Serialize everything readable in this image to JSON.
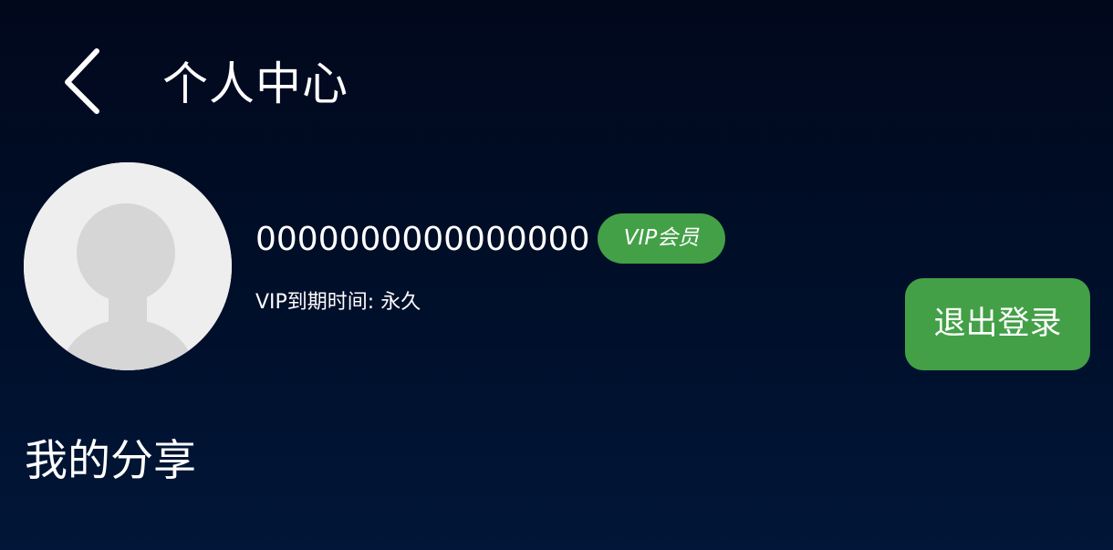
{
  "header": {
    "back_icon": "chevron-left-icon",
    "title": "个人中心"
  },
  "profile": {
    "avatar_icon": "default-avatar-icon",
    "username": "0000000000000000",
    "vip_badge": "VIP会员",
    "vip_expire": "VIP到期时间: 永久"
  },
  "actions": {
    "logout_label": "退出登录"
  },
  "sections": {
    "my_shares_title": "我的分享"
  },
  "colors": {
    "background_top": "#01081c",
    "background_bottom": "#011638",
    "accent_green": "#43a047",
    "avatar_bg": "#eeeeee",
    "avatar_silhouette": "#d6d6d6",
    "text": "#ffffff"
  }
}
